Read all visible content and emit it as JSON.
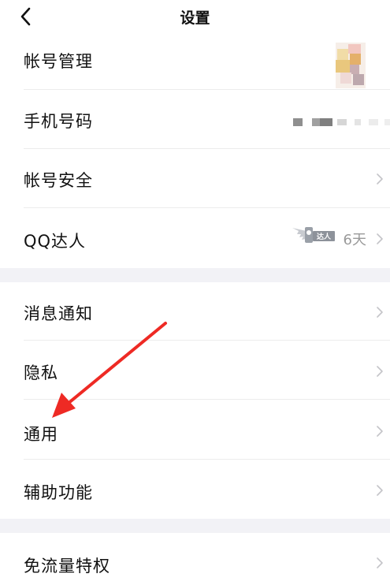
{
  "navbar": {
    "title": "设置"
  },
  "sections": [
    {
      "items": [
        {
          "label": "帐号管理"
        },
        {
          "label": "手机号码"
        },
        {
          "label": "帐号安全"
        },
        {
          "label": "QQ达人",
          "badge_text": "达人",
          "value": "6天"
        }
      ]
    },
    {
      "items": [
        {
          "label": "消息通知"
        },
        {
          "label": "隐私"
        },
        {
          "label": "通用"
        },
        {
          "label": "辅助功能"
        }
      ]
    },
    {
      "items": [
        {
          "label": "免流量特权"
        }
      ]
    }
  ],
  "colors": {
    "background": "#ffffff",
    "section_gap": "#f2f2f6",
    "chevron": "#c4c4c8",
    "secondary_text": "#9a9a9a",
    "annotation_arrow": "#ee2a24"
  },
  "icons": [
    "chevron-left-icon",
    "chevron-right-icon"
  ]
}
